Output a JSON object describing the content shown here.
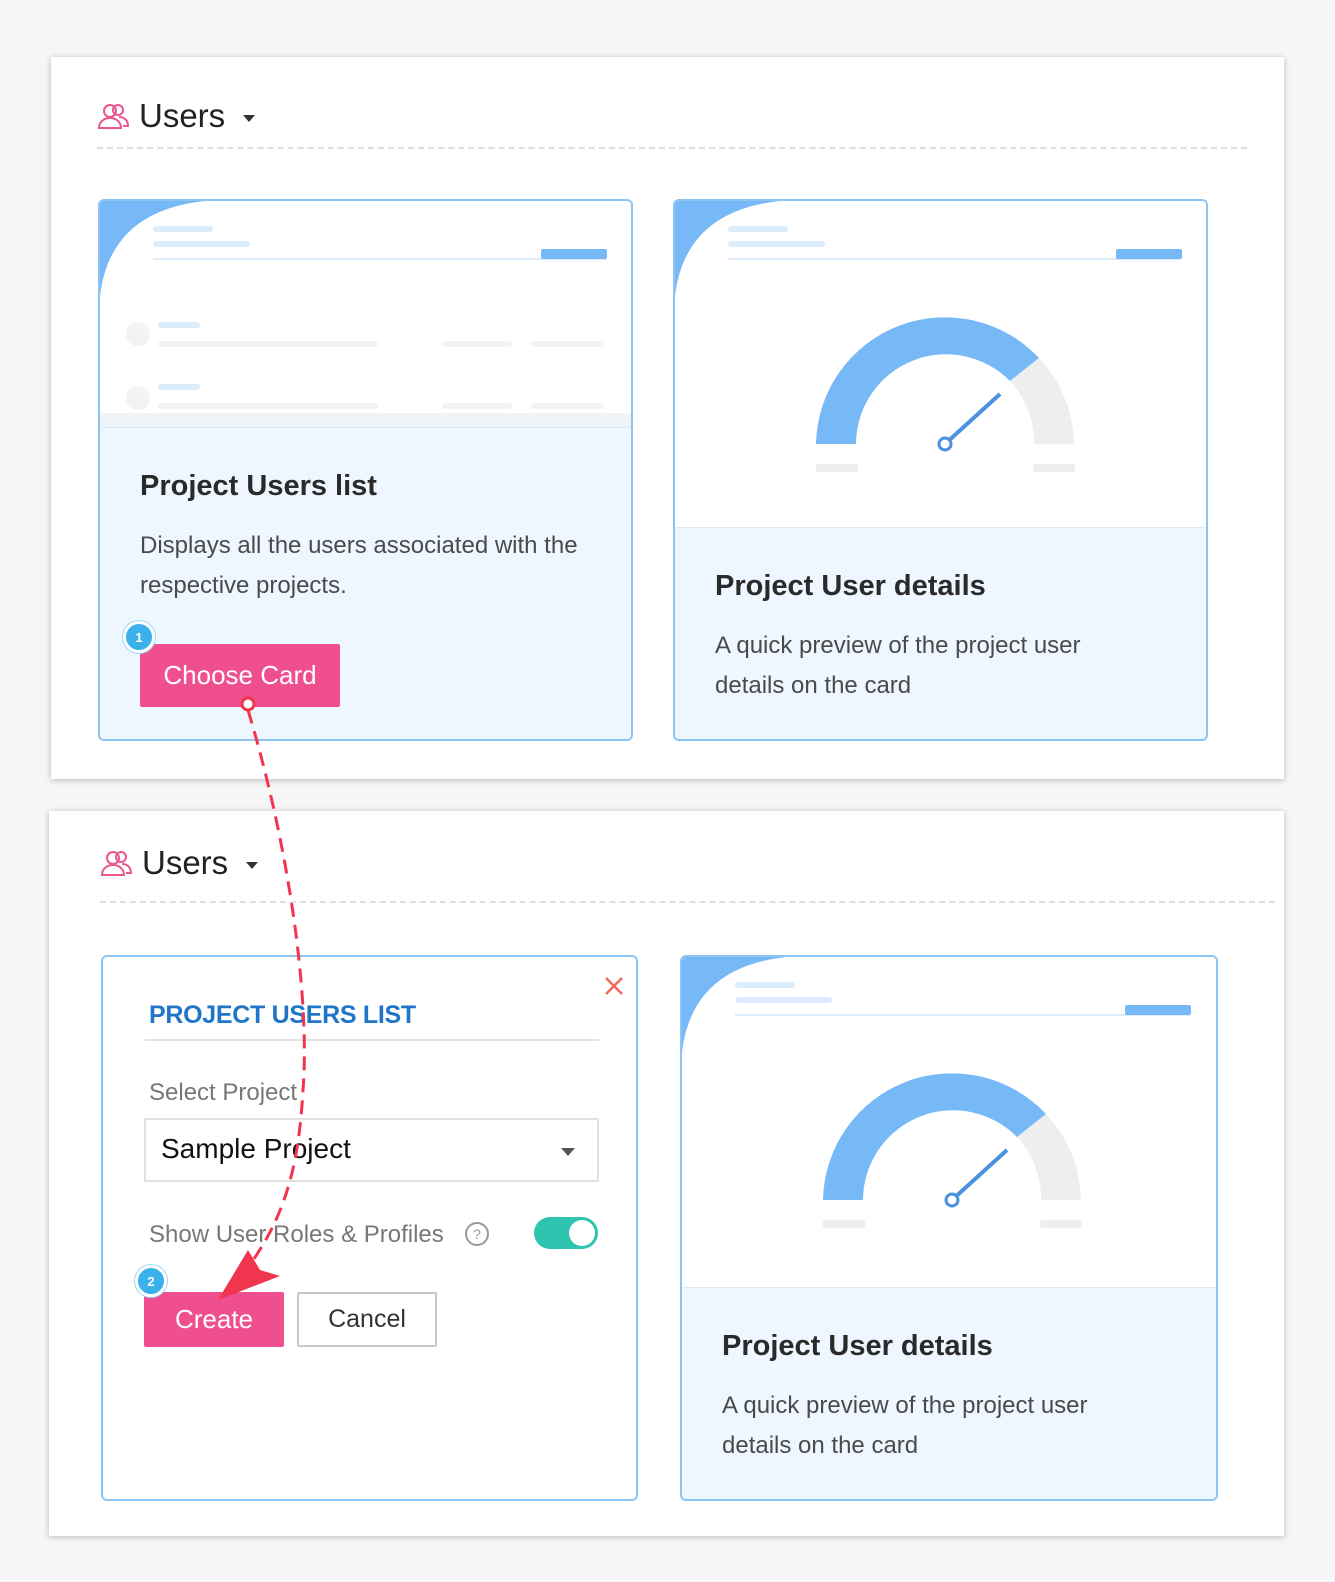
{
  "colors": {
    "accent_pink": "#ef4f8f",
    "card_border": "#8cc4f4",
    "gauge_blue": "#76b9f6",
    "form_title_blue": "#1f76c9",
    "toggle_on": "#2ec4b0",
    "arrow_red": "#f0364e"
  },
  "top_panel": {
    "header": {
      "title": "Users",
      "icon": "users-icon"
    },
    "cards": [
      {
        "title": "Project Users list",
        "description": "Displays all the users associated with the respective projects.",
        "button_label": "Choose Card",
        "step": "1"
      },
      {
        "title": "Project User details",
        "description": "A quick preview of the project user details on the card"
      }
    ]
  },
  "bottom_panel": {
    "header": {
      "title": "Users",
      "icon": "users-icon"
    },
    "form": {
      "title": "PROJECT USERS LIST",
      "select_label": "Select Project",
      "select_value": "Sample Project",
      "toggle_label": "Show User Roles & Profiles",
      "toggle_on": true,
      "help_glyph": "?",
      "create_label": "Create",
      "cancel_label": "Cancel",
      "step": "2"
    },
    "card": {
      "title": "Project User details",
      "description": "A quick preview of the project user details on the card"
    }
  }
}
